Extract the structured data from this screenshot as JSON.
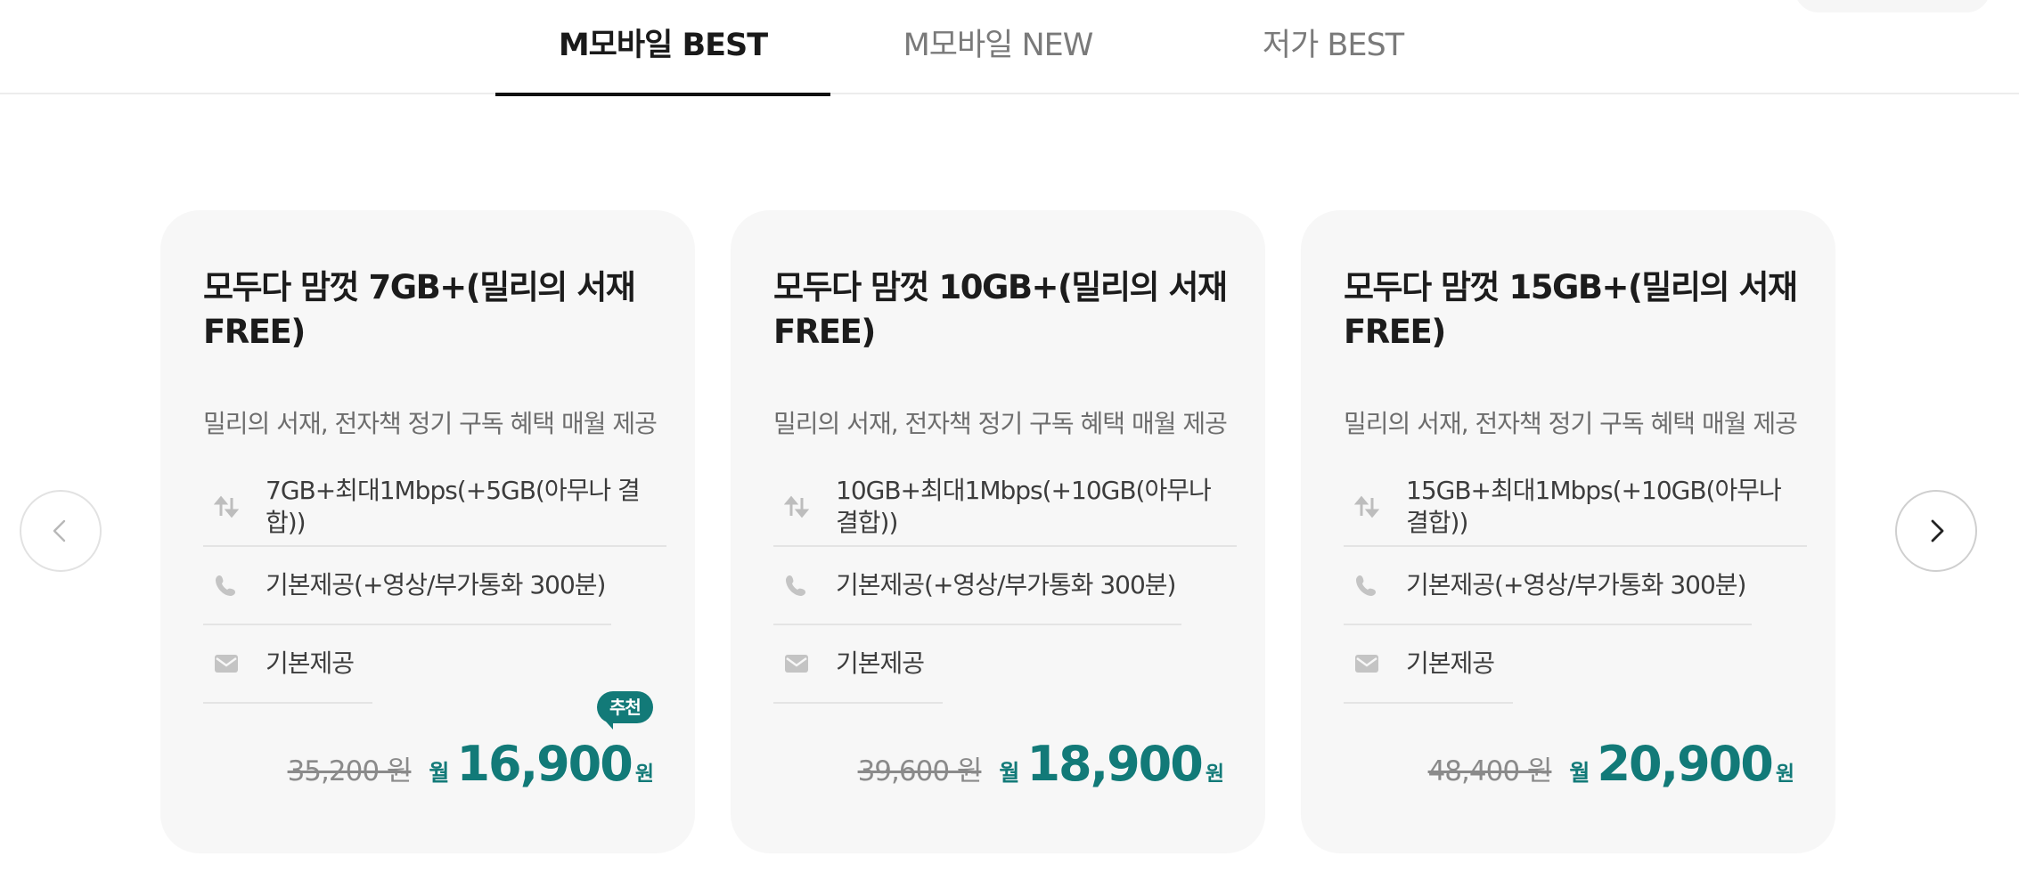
{
  "tabs": [
    {
      "label": "M모바일 BEST",
      "active": true
    },
    {
      "label": "M모바일 NEW",
      "active": false
    },
    {
      "label": "저가 BEST",
      "active": false
    }
  ],
  "carousel": {
    "prev_icon": "chevron-left-icon",
    "next_icon": "chevron-right-icon"
  },
  "icons": {
    "data": "updown-arrows-icon",
    "voice": "phone-icon",
    "sms": "mail-icon"
  },
  "colors": {
    "accent": "#127a78",
    "card_bg": "#f7f7f7",
    "icon": "#bdbdbd"
  },
  "plans": [
    {
      "title": "모두다 맘껏 7GB+(밀리의 서재 FREE)",
      "description": "밀리의 서재, 전자책 정기 구독 혜택 매월 제공",
      "data": "7GB+최대1Mbps(+5GB(아무나 결합))",
      "voice": "기본제공(+영상/부가통화 300분)",
      "sms": "기본제공",
      "original_price": "35,200 원",
      "month_label": "월",
      "price": "16,900",
      "currency": "원",
      "badge": "추천"
    },
    {
      "title": "모두다 맘껏 10GB+(밀리의 서재 FREE)",
      "description": "밀리의 서재, 전자책 정기 구독 혜택 매월 제공",
      "data": "10GB+최대1Mbps(+10GB(아무나 결합))",
      "voice": "기본제공(+영상/부가통화 300분)",
      "sms": "기본제공",
      "original_price": "39,600 원",
      "month_label": "월",
      "price": "18,900",
      "currency": "원"
    },
    {
      "title": "모두다 맘껏 15GB+(밀리의 서재 FREE)",
      "description": "밀리의 서재, 전자책 정기 구독 혜택 매월 제공",
      "data": "15GB+최대1Mbps(+10GB(아무나 결합))",
      "voice": "기본제공(+영상/부가통화 300분)",
      "sms": "기본제공",
      "original_price": "48,400 원",
      "month_label": "월",
      "price": "20,900",
      "currency": "원"
    }
  ]
}
